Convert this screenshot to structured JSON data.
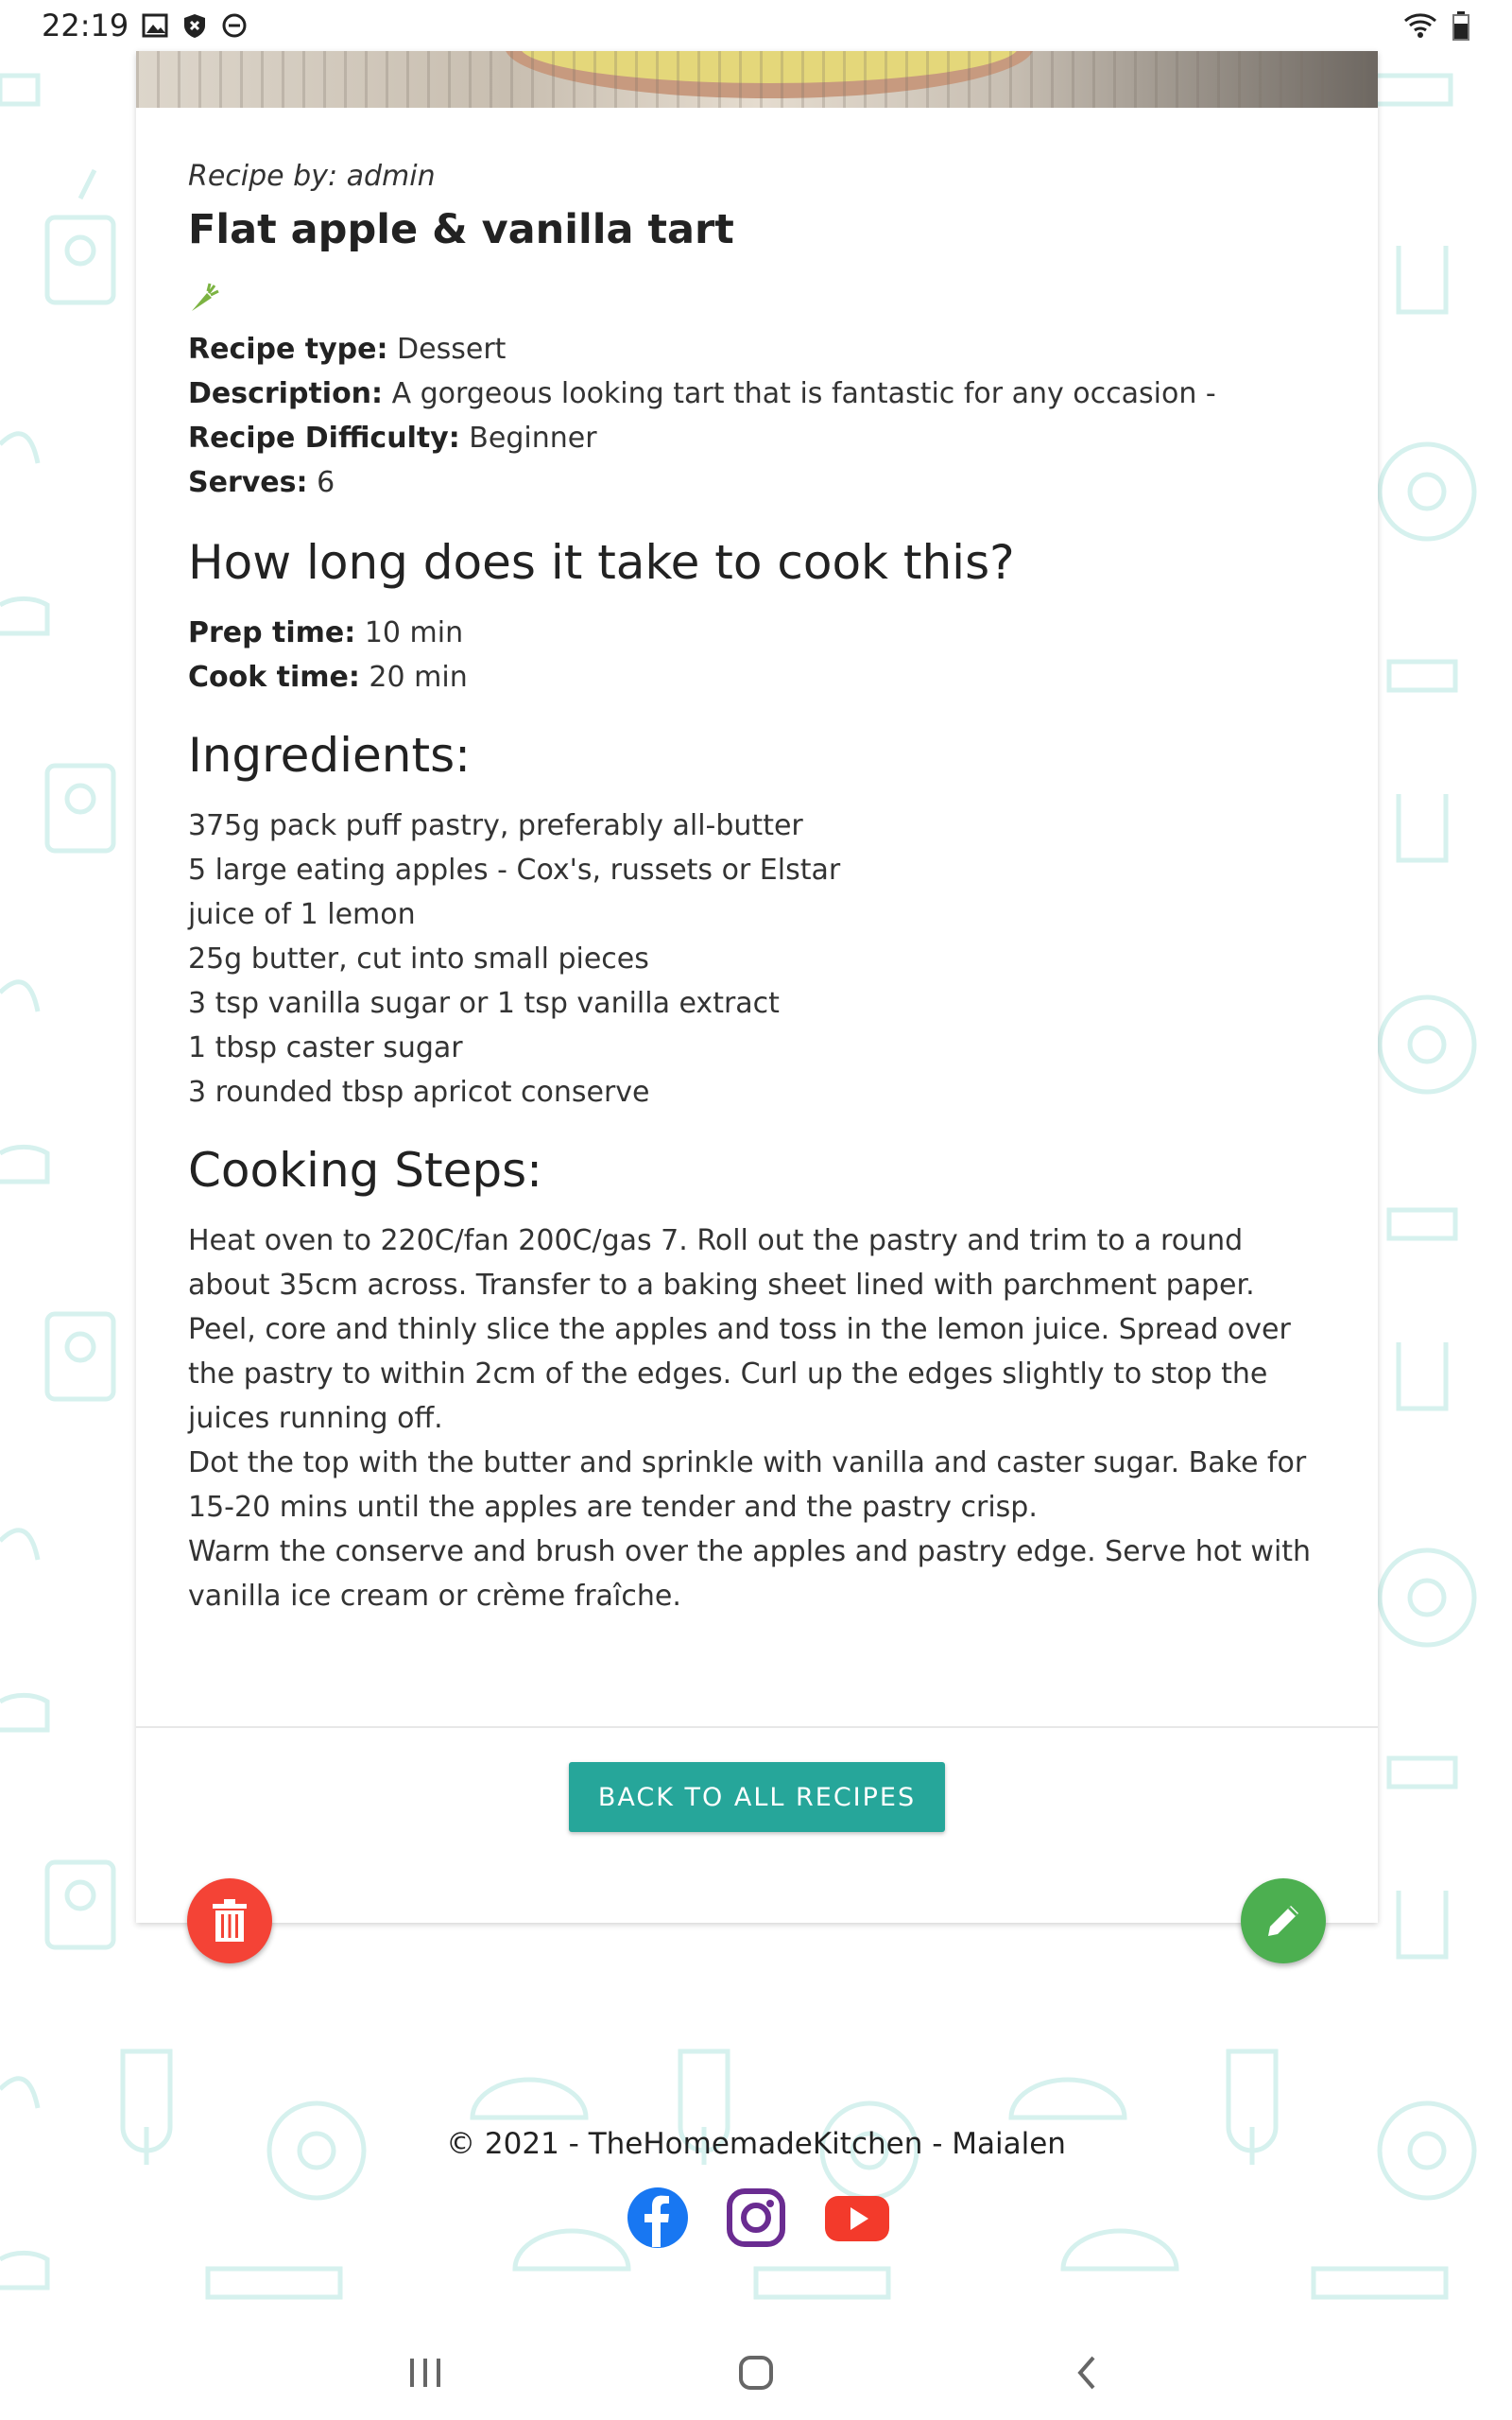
{
  "status_bar": {
    "time": "22:19"
  },
  "recipe": {
    "author_label": "Recipe by: admin",
    "title": "Flat apple & vanilla tart",
    "type_label": "Recipe type:",
    "type_value": "Dessert",
    "description_label": "Description:",
    "description_value": "A gorgeous looking tart that is fantastic for any occasion -",
    "difficulty_label": "Recipe Difficulty:",
    "difficulty_value": "Beginner",
    "serves_label": "Serves:",
    "serves_value": "6",
    "time_heading": "How long does it take to cook this?",
    "prep_label": "Prep time:",
    "prep_value": "10 min",
    "cook_label": "Cook time:",
    "cook_value": "20 min",
    "ingredients_heading": "Ingredients:",
    "ingredients": [
      "375g pack puff pastry, preferably all-butter",
      "5 large eating apples - Cox's, russets or Elstar",
      "juice of 1 lemon",
      "25g butter, cut into small pieces",
      "3 tsp vanilla sugar or 1 tsp vanilla extract",
      "1 tbsp caster sugar",
      "3 rounded tbsp apricot conserve"
    ],
    "steps_heading": "Cooking Steps:",
    "steps": [
      "Heat oven to 220C/fan 200C/gas 7. Roll out the pastry and trim to a round about 35cm across. Transfer to a baking sheet lined with parchment paper.",
      "Peel, core and thinly slice the apples and toss in the lemon juice. Spread over the pastry to within 2cm of the edges. Curl up the edges slightly to stop the juices running off.",
      "Dot the top with the butter and sprinkle with vanilla and caster sugar. Bake for 15-20 mins until the apples are tender and the pastry crisp.",
      "Warm the conserve and brush over the apples and pastry edge. Serve hot with vanilla ice cream or crème fraîche."
    ],
    "back_button": "BACK TO ALL RECIPES"
  },
  "footer": {
    "copyright": "© 2021 - TheHomemadeKitchen - Maialen"
  },
  "colors": {
    "accent": "#26a69a",
    "delete": "#f44336",
    "edit": "#4caf50",
    "facebook": "#1877f2",
    "instagram": "#6a2c91",
    "youtube": "#f33a2b"
  },
  "icons": [
    "carrot-icon",
    "trash-icon",
    "pencil-icon",
    "facebook-icon",
    "instagram-icon",
    "youtube-icon"
  ]
}
